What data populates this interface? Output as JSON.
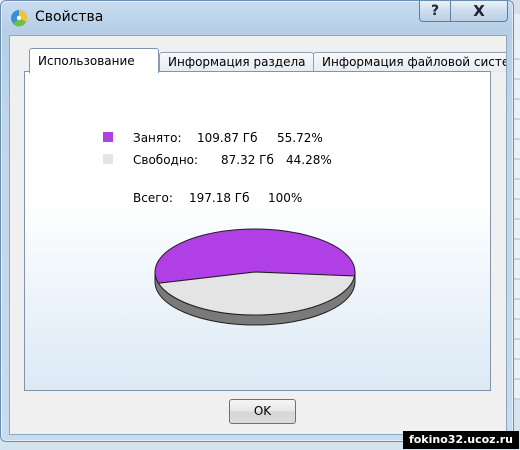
{
  "window": {
    "title": "Свойства",
    "help_label": "?",
    "close_label": "X"
  },
  "tabs": [
    {
      "label": "Использование",
      "active": true
    },
    {
      "label": "Информация раздела",
      "active": false
    },
    {
      "label": "Информация файловой систе",
      "active": false
    }
  ],
  "usage": {
    "used": {
      "label": "Занято:",
      "size": "109.87 Гб",
      "percent": "55.72%",
      "color": "#b03fe6"
    },
    "free": {
      "label": "Свободно:",
      "size": "87.32 Гб",
      "percent": "44.28%",
      "color": "#e4e4e4"
    },
    "total": {
      "label": "Всего:",
      "size": "197.18 Гб",
      "percent": "100%"
    }
  },
  "chart_data": {
    "type": "pie",
    "categories": [
      "Занято",
      "Свободно"
    ],
    "values": [
      55.72,
      44.28
    ],
    "colors": [
      "#b03fe6",
      "#e4e4e4"
    ]
  },
  "buttons": {
    "ok_label": "OK"
  },
  "watermark": "fokino32.ucoz.ru"
}
